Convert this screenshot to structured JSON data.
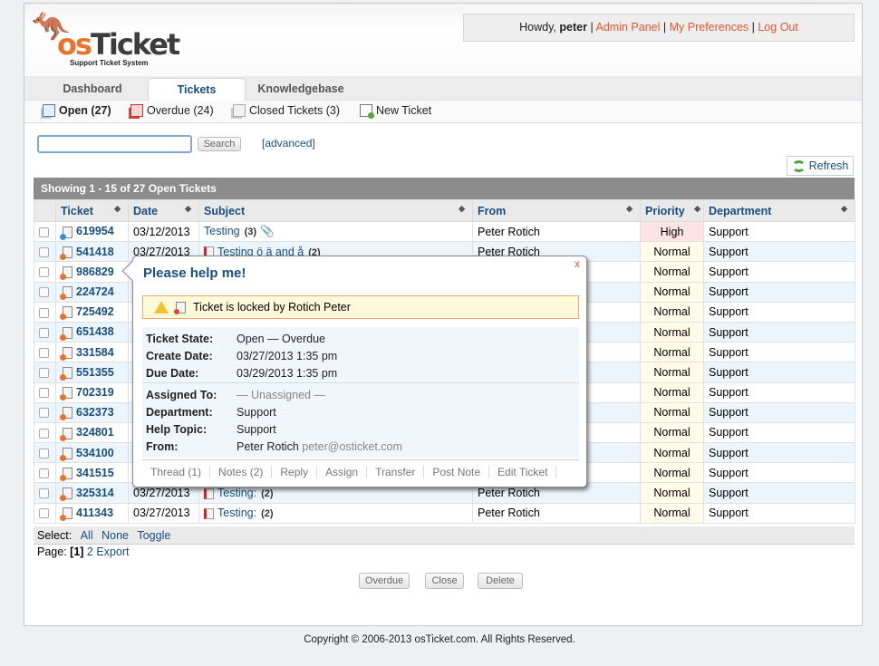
{
  "app": {
    "name": "osTicket",
    "tagline": "Support Ticket System"
  },
  "userbar": {
    "greeting": "Howdy,",
    "user": "peter",
    "links": [
      "Admin Panel",
      "My Preferences",
      "Log Out"
    ],
    "sep": "|"
  },
  "nav": {
    "tabs": [
      "Dashboard",
      "Tickets",
      "Knowledgebase"
    ],
    "active": "Tickets"
  },
  "subnav": [
    {
      "label": "Open (27)",
      "icon": "open-tickets-icon"
    },
    {
      "label": "Overdue (24)",
      "icon": "overdue-tickets-icon"
    },
    {
      "label": "Closed Tickets (3)",
      "icon": "closed-tickets-icon"
    },
    {
      "label": "New Ticket",
      "icon": "new-ticket-icon"
    }
  ],
  "search": {
    "value": "",
    "button": "Search",
    "advanced": "[advanced]"
  },
  "refresh": "Refresh",
  "showing": "Showing  1 - 15 of 27   Open Tickets",
  "columns": [
    "Ticket",
    "Date",
    "Subject",
    "From",
    "Priority",
    "Department"
  ],
  "rows": [
    {
      "ticket": "619954",
      "date": "03/12/2013",
      "subject": "Testing",
      "count": "(3)",
      "attach": true,
      "from": "Peter Rotich",
      "priority": "High",
      "dept": "Support"
    },
    {
      "ticket": "541418",
      "date": "03/27/2013",
      "subject": "Testing ö ä and å",
      "count": "(2)",
      "from": "Peter Rotich",
      "priority": "Normal",
      "dept": "Support"
    },
    {
      "ticket": "986829",
      "date": "",
      "subject": "",
      "count": "",
      "from": "",
      "priority": "Normal",
      "dept": "Support"
    },
    {
      "ticket": "224724",
      "date": "",
      "subject": "",
      "count": "",
      "from": "",
      "priority": "Normal",
      "dept": "Support"
    },
    {
      "ticket": "725492",
      "date": "",
      "subject": "",
      "count": "",
      "from": "",
      "priority": "Normal",
      "dept": "Support"
    },
    {
      "ticket": "651438",
      "date": "",
      "subject": "",
      "count": "",
      "from": "",
      "priority": "Normal",
      "dept": "Support"
    },
    {
      "ticket": "331584",
      "date": "",
      "subject": "",
      "count": "",
      "from": "",
      "priority": "Normal",
      "dept": "Support"
    },
    {
      "ticket": "551355",
      "date": "",
      "subject": "",
      "count": "",
      "from": "",
      "priority": "Normal",
      "dept": "Support"
    },
    {
      "ticket": "702319",
      "date": "",
      "subject": "",
      "count": "",
      "from": "",
      "priority": "Normal",
      "dept": "Support"
    },
    {
      "ticket": "632373",
      "date": "",
      "subject": "",
      "count": "",
      "from": "",
      "priority": "Normal",
      "dept": "Support"
    },
    {
      "ticket": "324801",
      "date": "",
      "subject": "",
      "count": "",
      "from": "",
      "priority": "Normal",
      "dept": "Support"
    },
    {
      "ticket": "534100",
      "date": "",
      "subject": "",
      "count": "",
      "from": "",
      "priority": "Normal",
      "dept": "Support"
    },
    {
      "ticket": "341515",
      "date": "",
      "subject": "",
      "count": "",
      "from": "",
      "priority": "Normal",
      "dept": "Support"
    },
    {
      "ticket": "325314",
      "date": "03/27/2013",
      "subject": "Testing:",
      "count": "(2)",
      "from": "Peter Rotich",
      "priority": "Normal",
      "dept": "Support"
    },
    {
      "ticket": "411343",
      "date": "03/27/2013",
      "subject": "Testing:",
      "count": "(2)",
      "from": "Peter Rotich",
      "priority": "Normal",
      "dept": "Support"
    }
  ],
  "select": {
    "label": "Select:",
    "links": [
      "All",
      "None",
      "Toggle"
    ]
  },
  "pager": {
    "label": "Page:",
    "current": "[1]",
    "next": "2",
    "export": "Export"
  },
  "actions": [
    "Overdue",
    "Close",
    "Delete"
  ],
  "footer": "Copyright © 2006-2013 osTicket.com.  All Rights Reserved.",
  "popup": {
    "title": "Please help me!",
    "close": "x",
    "lock_msg": "Ticket is locked by Rotich Peter",
    "block1": [
      {
        "k": "Ticket State:",
        "v": "Open — Overdue"
      },
      {
        "k": "Create Date:",
        "v": "03/27/2013 1:35 pm"
      },
      {
        "k": "Due Date:",
        "v": "03/29/2013 1:35 pm"
      }
    ],
    "block2": [
      {
        "k": "Assigned To:",
        "v": "— Unassigned —"
      },
      {
        "k": "Department:",
        "v": "Support"
      },
      {
        "k": "Help Topic:",
        "v": "Support"
      },
      {
        "k": "From:",
        "v": "Peter Rotich",
        "extra": "peter@osticket.com"
      }
    ],
    "actions": [
      "Thread (1)",
      "Notes (2)",
      "Reply",
      "Assign",
      "Transfer",
      "Post Note",
      "Edit Ticket"
    ]
  }
}
